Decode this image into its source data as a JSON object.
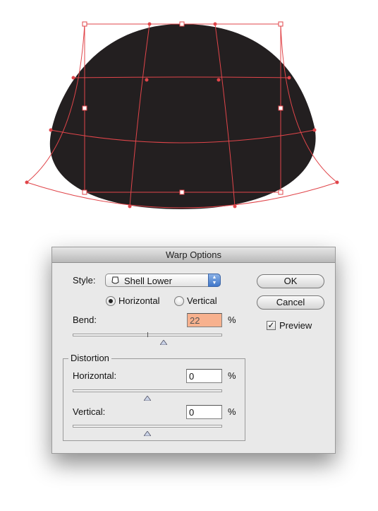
{
  "dialog": {
    "title": "Warp Options",
    "style_label": "Style:",
    "style_value": "Shell Lower",
    "orientation": {
      "horizontal_label": "Horizontal",
      "vertical_label": "Vertical",
      "selected": "horizontal"
    },
    "bend": {
      "label": "Bend:",
      "value": "22",
      "unit": "%",
      "slider_fraction": 0.61
    },
    "distortion": {
      "group_title": "Distortion",
      "horizontal": {
        "label": "Horizontal:",
        "value": "0",
        "unit": "%",
        "slider_fraction": 0.5
      },
      "vertical": {
        "label": "Vertical:",
        "value": "0",
        "unit": "%",
        "slider_fraction": 0.5
      }
    },
    "buttons": {
      "ok": "OK",
      "cancel": "Cancel"
    },
    "preview": {
      "label": "Preview",
      "checked": true
    }
  },
  "colors": {
    "shape_fill": "#231f20",
    "envelope_stroke": "#e0454a",
    "bend_field_highlight": "#f7b18e"
  }
}
